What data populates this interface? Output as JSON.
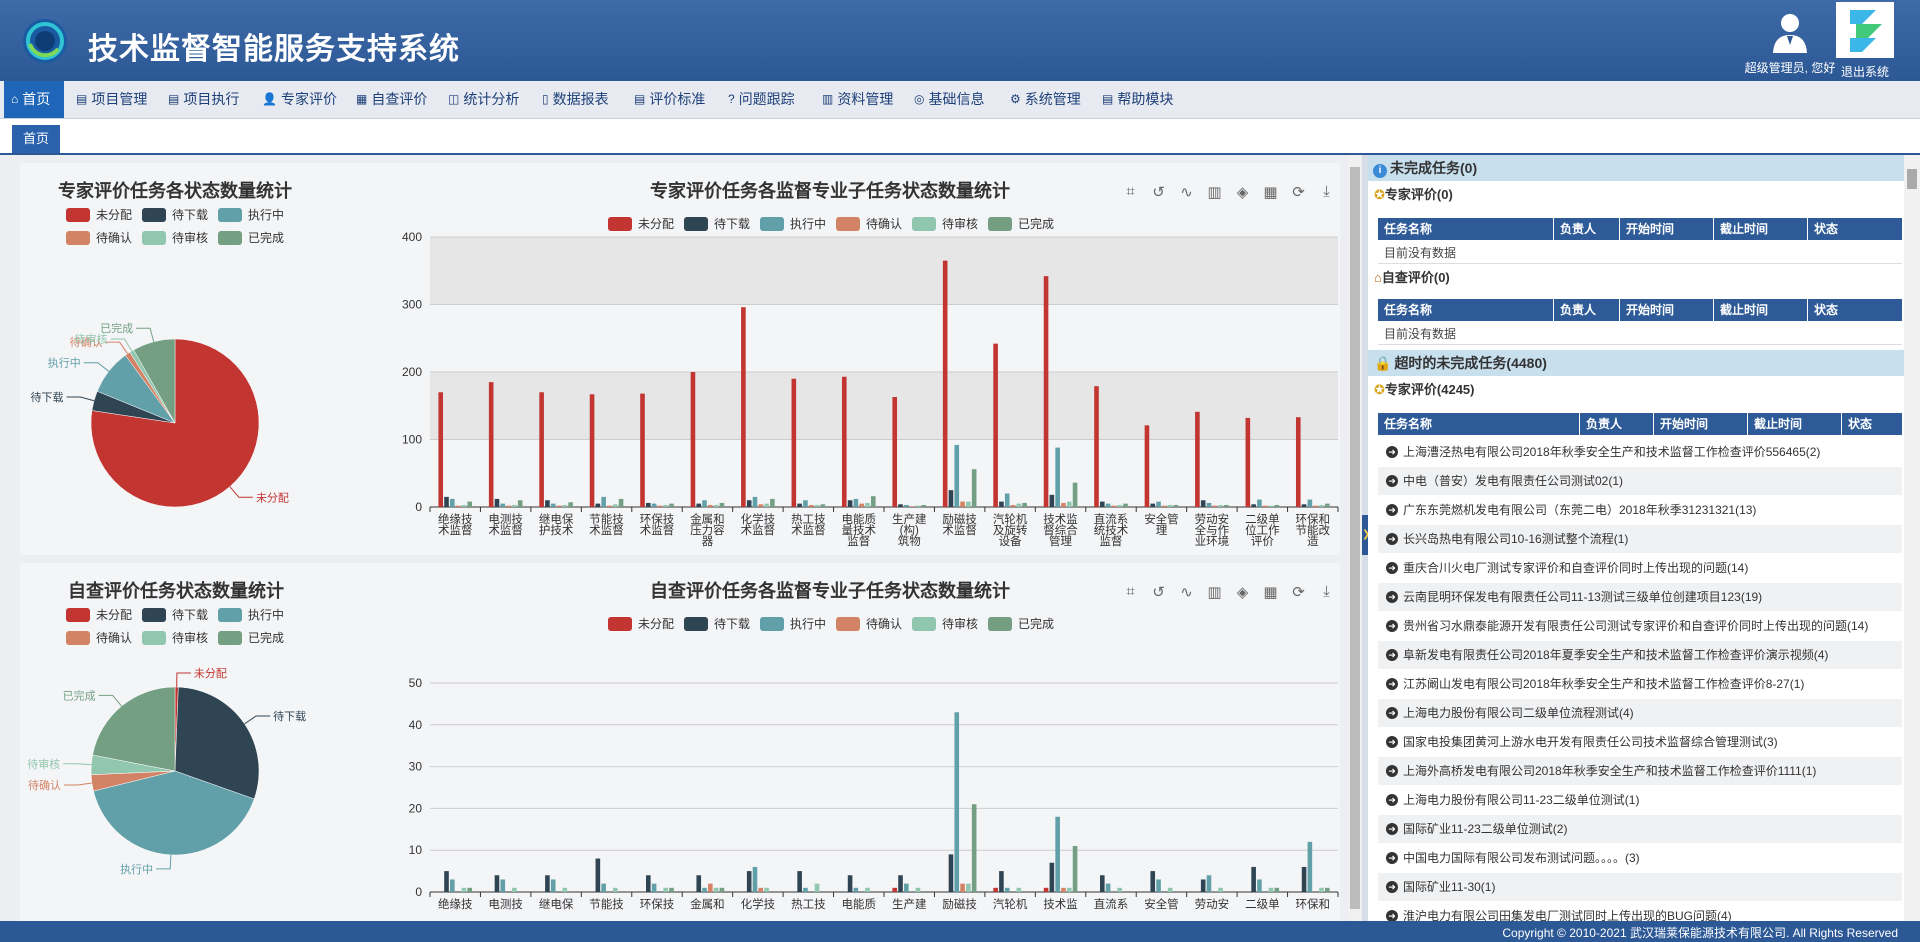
{
  "header": {
    "title": "技术监督智能服务支持系统",
    "user_label": "超级管理员, 您好",
    "logout_label": "退出系统"
  },
  "nav": {
    "items": [
      {
        "label": "首页",
        "icon": "home-icon"
      },
      {
        "label": "项目管理",
        "icon": "project-icon"
      },
      {
        "label": "项目执行",
        "icon": "execute-icon"
      },
      {
        "label": "专家评价",
        "icon": "expert-icon"
      },
      {
        "label": "自查评价",
        "icon": "selfcheck-icon"
      },
      {
        "label": "统计分析",
        "icon": "stats-icon"
      },
      {
        "label": "数据报表",
        "icon": "report-icon"
      },
      {
        "label": "评价标准",
        "icon": "standard-icon"
      },
      {
        "label": "问题跟踪",
        "icon": "question-icon"
      },
      {
        "label": "资料管理",
        "icon": "library-icon"
      },
      {
        "label": "基础信息",
        "icon": "globe-icon"
      },
      {
        "label": "系统管理",
        "icon": "gear-icon"
      },
      {
        "label": "帮助模块",
        "icon": "help-icon"
      }
    ]
  },
  "tabs": {
    "home": "首页"
  },
  "colors": {
    "未分配": "#c23531",
    "待下载": "#2f4554",
    "执行中": "#61a0a8",
    "待确认": "#d48265",
    "待审核": "#91c7ae",
    "已完成": "#749f83"
  },
  "toolbox_icons": [
    "zoom-icon",
    "zoom-reset-icon",
    "line-icon",
    "bar-icon",
    "stack-icon",
    "tiled-icon",
    "refresh-icon",
    "download-icon"
  ],
  "chart_data": [
    {
      "type": "pie",
      "title": "专家评价任务各状态数量统计",
      "legend": [
        "未分配",
        "待下载",
        "执行中",
        "待确认",
        "待审核",
        "已完成"
      ],
      "slices": [
        {
          "name": "未分配",
          "value": 2650
        },
        {
          "name": "待下载",
          "value": 130
        },
        {
          "name": "执行中",
          "value": 300
        },
        {
          "name": "待确认",
          "value": 35
        },
        {
          "name": "待审核",
          "value": 30
        },
        {
          "name": "已完成",
          "value": 280
        }
      ]
    },
    {
      "type": "bar",
      "title": "专家评价任务各监督专业子任务状态数量统计",
      "legend": [
        "未分配",
        "待下载",
        "执行中",
        "待确认",
        "待审核",
        "已完成"
      ],
      "ylim": [
        0,
        400
      ],
      "yticks": [
        0,
        100,
        200,
        300,
        400
      ],
      "categories": [
        "绝缘技术监督",
        "电测技术监督",
        "继电保护技术",
        "节能技术监督",
        "环保技术监督",
        "金属和压力容器",
        "化学技术监督",
        "热工技术监督",
        "电能质量技术监督",
        "生产建(构)筑物",
        "励磁技术监督",
        "汽轮机及旋转设备",
        "技术监督综合管理",
        "直流系统技术监督",
        "安全管理",
        "劳动安全与作业环境",
        "二级单位工作评价",
        "环保和节能改造"
      ],
      "category_lines": [
        [
          "绝缘技",
          "术监督"
        ],
        [
          "电测技",
          "术监督"
        ],
        [
          "继电保",
          "护技术"
        ],
        [
          "节能技",
          "术监督"
        ],
        [
          "环保技",
          "术监督"
        ],
        [
          "金属和",
          "压力容",
          "器"
        ],
        [
          "化学技",
          "术监督"
        ],
        [
          "热工技",
          "术监督"
        ],
        [
          "电能质",
          "量技术",
          "监督"
        ],
        [
          "生产建",
          "(构)",
          "筑物"
        ],
        [
          "励磁技",
          "术监督"
        ],
        [
          "汽轮机",
          "及旋转",
          "设备"
        ],
        [
          "技术监",
          "督综合",
          "管理"
        ],
        [
          "直流系",
          "统技术",
          "监督"
        ],
        [
          "安全管",
          "理"
        ],
        [
          "劳动安",
          "全与作",
          "业环境"
        ],
        [
          "二级单",
          "位工作",
          "评价"
        ],
        [
          "环保和",
          "节能改",
          "造"
        ]
      ],
      "series": [
        {
          "name": "未分配",
          "values": [
            170,
            185,
            170,
            167,
            168,
            200,
            296,
            190,
            193,
            163,
            365,
            242,
            342,
            179,
            121,
            141,
            132,
            133
          ]
        },
        {
          "name": "待下载",
          "values": [
            15,
            12,
            10,
            5,
            6,
            5,
            10,
            5,
            10,
            4,
            25,
            8,
            18,
            8,
            5,
            10,
            4,
            4
          ]
        },
        {
          "name": "执行中",
          "values": [
            12,
            5,
            5,
            15,
            5,
            10,
            15,
            10,
            12,
            3,
            92,
            20,
            88,
            5,
            8,
            6,
            11,
            11
          ]
        },
        {
          "name": "待确认",
          "values": [
            2,
            2,
            2,
            2,
            2,
            3,
            4,
            3,
            5,
            1,
            8,
            3,
            6,
            2,
            2,
            2,
            2,
            2
          ]
        },
        {
          "name": "待审核",
          "values": [
            3,
            3,
            3,
            4,
            3,
            3,
            5,
            3,
            6,
            2,
            8,
            5,
            8,
            3,
            3,
            3,
            2,
            3
          ]
        },
        {
          "name": "已完成",
          "values": [
            8,
            10,
            7,
            12,
            5,
            6,
            12,
            4,
            16,
            3,
            56,
            6,
            36,
            5,
            3,
            3,
            3,
            5
          ]
        }
      ]
    },
    {
      "type": "pie",
      "title": "自查评价任务状态数量统计",
      "legend": [
        "未分配",
        "待下载",
        "执行中",
        "待确认",
        "待审核",
        "已完成"
      ],
      "slices": [
        {
          "name": "未分配",
          "value": 2
        },
        {
          "name": "待下载",
          "value": 95
        },
        {
          "name": "执行中",
          "value": 130
        },
        {
          "name": "待确认",
          "value": 10
        },
        {
          "name": "待审核",
          "value": 12
        },
        {
          "name": "已完成",
          "value": 70
        }
      ]
    },
    {
      "type": "bar",
      "title": "自查评价任务各监督专业子任务状态数量统计",
      "legend": [
        "未分配",
        "待下载",
        "执行中",
        "待确认",
        "待审核",
        "已完成"
      ],
      "ylim": [
        0,
        50
      ],
      "yticks": [
        0,
        10,
        20,
        30,
        40,
        50
      ],
      "categories": [
        "绝缘技术监督",
        "电测技术监督",
        "继电保护技术",
        "节能技术监督",
        "环保技术监督",
        "金属和压力容器",
        "化学技术监督",
        "热工技术监督",
        "电能质量技术监督",
        "生产建(构)筑物",
        "励磁技术监督",
        "汽轮机及旋转设备",
        "技术监督综合管理",
        "直流系统技术监督",
        "安全管理",
        "劳动安全与作业环境",
        "二级单位工作评价",
        "环保和节能改造"
      ],
      "category_lines": [
        [
          "绝缘技"
        ],
        [
          "电测技"
        ],
        [
          "继电保"
        ],
        [
          "节能技"
        ],
        [
          "环保技"
        ],
        [
          "金属和"
        ],
        [
          "化学技"
        ],
        [
          "热工技"
        ],
        [
          "电能质"
        ],
        [
          "生产建"
        ],
        [
          "励磁技"
        ],
        [
          "汽轮机"
        ],
        [
          "技术监"
        ],
        [
          "直流系"
        ],
        [
          "安全管"
        ],
        [
          "劳动安"
        ],
        [
          "二级单"
        ],
        [
          "环保和"
        ]
      ],
      "series": [
        {
          "name": "未分配",
          "values": [
            0,
            0,
            0,
            0,
            0,
            0,
            0,
            0,
            0,
            1,
            0,
            1,
            1,
            0,
            0,
            0,
            0,
            0
          ]
        },
        {
          "name": "待下载",
          "values": [
            5,
            4,
            4,
            8,
            4,
            4,
            5,
            5,
            4,
            4,
            9,
            5,
            7,
            4,
            5,
            3,
            6,
            6
          ]
        },
        {
          "name": "执行中",
          "values": [
            3,
            3,
            3,
            2,
            2,
            1,
            6,
            1,
            1,
            2,
            43,
            1,
            18,
            2,
            3,
            4,
            3,
            12
          ]
        },
        {
          "name": "待确认",
          "values": [
            0,
            0,
            0,
            0,
            0,
            2,
            1,
            0,
            0,
            0,
            2,
            0,
            1,
            0,
            0,
            0,
            0,
            0
          ]
        },
        {
          "name": "待审核",
          "values": [
            1,
            1,
            1,
            1,
            1,
            1,
            1,
            2,
            1,
            1,
            2,
            1,
            1,
            1,
            1,
            1,
            1,
            1
          ]
        },
        {
          "name": "已完成",
          "values": [
            1,
            0,
            0,
            0,
            1,
            1,
            0,
            0,
            0,
            0,
            21,
            0,
            11,
            0,
            0,
            0,
            1,
            1
          ]
        }
      ]
    }
  ],
  "right_panel": {
    "unfinished": {
      "title": "未完成任务(0)",
      "expert": {
        "title": "专家评价(0)",
        "empty": "目前没有数据"
      },
      "self": {
        "title": "自查评价(0)",
        "empty": "目前没有数据"
      }
    },
    "overdue": {
      "title": "超时的未完成任务(4480)",
      "expert": {
        "title": "专家评价(4245)"
      }
    },
    "table_headers": [
      "任务名称",
      "负责人",
      "开始时间",
      "截止时间",
      "状态"
    ],
    "overdue_tasks": [
      "上海漕泾热电有限公司2018年秋季安全生产和技术监督工作检查评价556465(2)",
      "中电（普安）发电有限责任公司测试02(1)",
      "广东东莞燃机发电有限公司（东莞二电）2018年秋季31231321(13)",
      "长兴岛热电有限公司10-16测试整个流程(1)",
      "重庆合川火电厂测试专家评价和自查评价同时上传出现的问题(14)",
      "云南昆明环保发电有限责任公司11-13测试三级单位创建项目123(19)",
      "贵州省习水鼎泰能源开发有限责任公司测试专家评价和自查评价同时上传出现的问题(14)",
      "阜新发电有限责任公司2018年夏季安全生产和技术监督工作检查评价演示视频(4)",
      "江苏阚山发电有限公司2018年秋季安全生产和技术监督工作检查评价8-27(1)",
      "上海电力股份有限公司二级单位流程测试(4)",
      "国家电投集团黄河上游水电开发有限责任公司技术监督综合管理测试(3)",
      "上海外高桥发电有限公司2018年秋季安全生产和技术监督工作检查评价1111(1)",
      "上海电力股份有限公司11-23二级单位测试(1)",
      "国际矿业11-23二级单位测试(2)",
      "中国电力国际有限公司发布测试问题。。。。(3)",
      "国际矿业11-30(1)",
      "淮沪电力有限公司田集发电厂测试同时上传出现的BUG问题(4)"
    ]
  },
  "footer": {
    "copyright": "Copyright © 2010-2021 武汉瑞莱保能源技术有限公司. All Rights Reserved"
  }
}
